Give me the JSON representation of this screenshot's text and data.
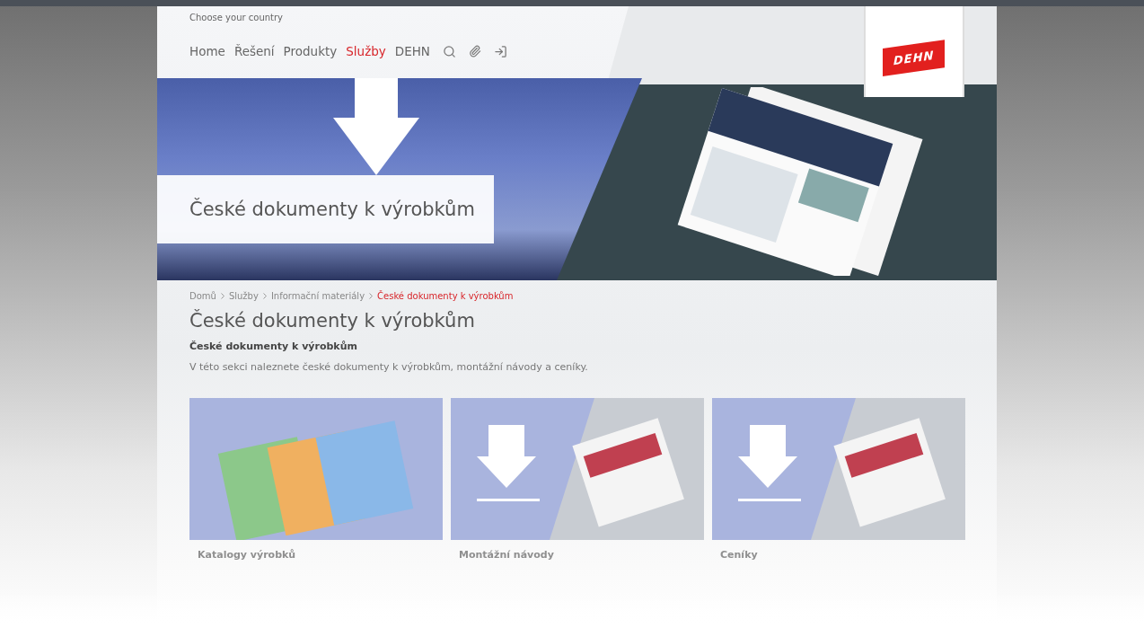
{
  "header": {
    "country_link": "Choose your country",
    "nav": [
      {
        "label": "Home",
        "selected": false
      },
      {
        "label": "Řešení",
        "selected": false
      },
      {
        "label": "Produkty",
        "selected": false
      },
      {
        "label": "Služby",
        "selected": true
      },
      {
        "label": "DEHN",
        "selected": false
      }
    ],
    "logo": "DEHN"
  },
  "hero": {
    "title": "České dokumenty k výrobkům"
  },
  "breadcrumb": [
    {
      "label": "Domů",
      "selected": false
    },
    {
      "label": "Služby",
      "selected": false
    },
    {
      "label": "Informační materiály",
      "selected": false
    },
    {
      "label": "České dokumenty k výrobkům",
      "selected": true
    }
  ],
  "page_title": "České dokumenty k výrobkům",
  "subtitle": "České dokumenty k výrobkům",
  "intro": "V této sekci naleznete české dokumenty k výrobkům, montážní návody a ceníky.",
  "cards": [
    {
      "kind": "catalog",
      "title": "Katalogy výrobků"
    },
    {
      "kind": "download",
      "title": "Montážní návody"
    },
    {
      "kind": "download",
      "title": "Ceníky"
    }
  ]
}
